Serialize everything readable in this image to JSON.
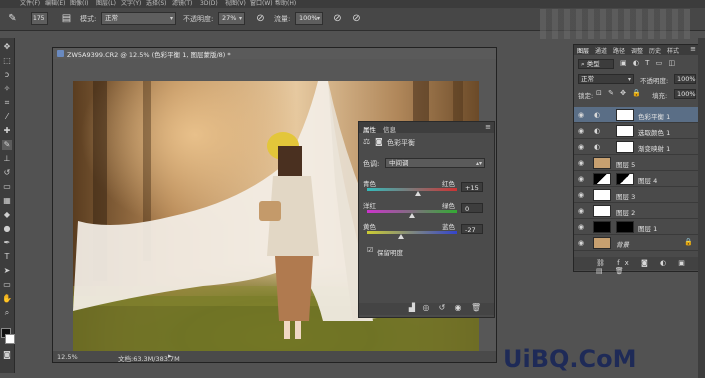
{
  "menubar": {
    "items": [
      "文件(F)",
      "编辑(E)",
      "图像(I)",
      "图层(L)",
      "文字(Y)",
      "选择(S)",
      "滤镜(T)",
      "3D(D)",
      "视图(V)",
      "窗口(W)",
      "帮助(H)"
    ]
  },
  "options": {
    "brush_size": "175",
    "mode_label": "模式:",
    "mode_value": "正常",
    "opacity_label": "不透明度:",
    "opacity_value": "27%",
    "flow_label": "流量:",
    "flow_value": "100%"
  },
  "document": {
    "tab_title": "ZW5A9399.CR2 @ 12.5% (色彩平衡 1, 图层蒙版/8) *",
    "zoom": "12.5%",
    "doc_info": "文档:63.3M/383.7M"
  },
  "properties": {
    "tabs": [
      "属性",
      "信息"
    ],
    "title": "色彩平衡",
    "tone_label": "色调:",
    "tone_value": "中间调",
    "sliders": [
      {
        "left": "青色",
        "right": "红色",
        "value": "+15",
        "level": 0.57,
        "gradient": [
          "#33bbbb",
          "#cc3333"
        ]
      },
      {
        "left": "洋红",
        "right": "绿色",
        "value": "0",
        "level": 0.5,
        "gradient": [
          "#cc33cc",
          "#33aa33"
        ]
      },
      {
        "left": "黄色",
        "right": "蓝色",
        "value": "-27",
        "level": 0.38,
        "gradient": [
          "#cccc33",
          "#3344cc"
        ]
      }
    ],
    "preserve_label": "保留明度",
    "preserve_checked": true
  },
  "layers": {
    "tabs": [
      "图层",
      "通道",
      "路径",
      "调整",
      "历史",
      "样式"
    ],
    "filter_value": "类型",
    "blend_mode": "正常",
    "opacity_label": "不透明度:",
    "opacity_value": "100%",
    "lock_label": "锁定:",
    "fill_label": "填充:",
    "fill_value": "100%",
    "items": [
      {
        "name": "色彩平衡 1",
        "selected": true
      },
      {
        "name": "选取颜色 1",
        "selected": false
      },
      {
        "name": "渐变映射 1",
        "selected": false
      },
      {
        "name": "图层 5",
        "selected": false
      },
      {
        "name": "图层 4",
        "selected": false
      },
      {
        "name": "图层 3",
        "selected": false
      },
      {
        "name": "图层 2",
        "selected": false
      },
      {
        "name": "图层 1",
        "selected": false
      },
      {
        "name": "背景",
        "selected": false
      }
    ]
  },
  "watermark": {
    "text": "UiBQ.CoM"
  },
  "colors": {
    "selected_layer": "#5a6e86",
    "panel_bg": "#4b4b4b"
  }
}
